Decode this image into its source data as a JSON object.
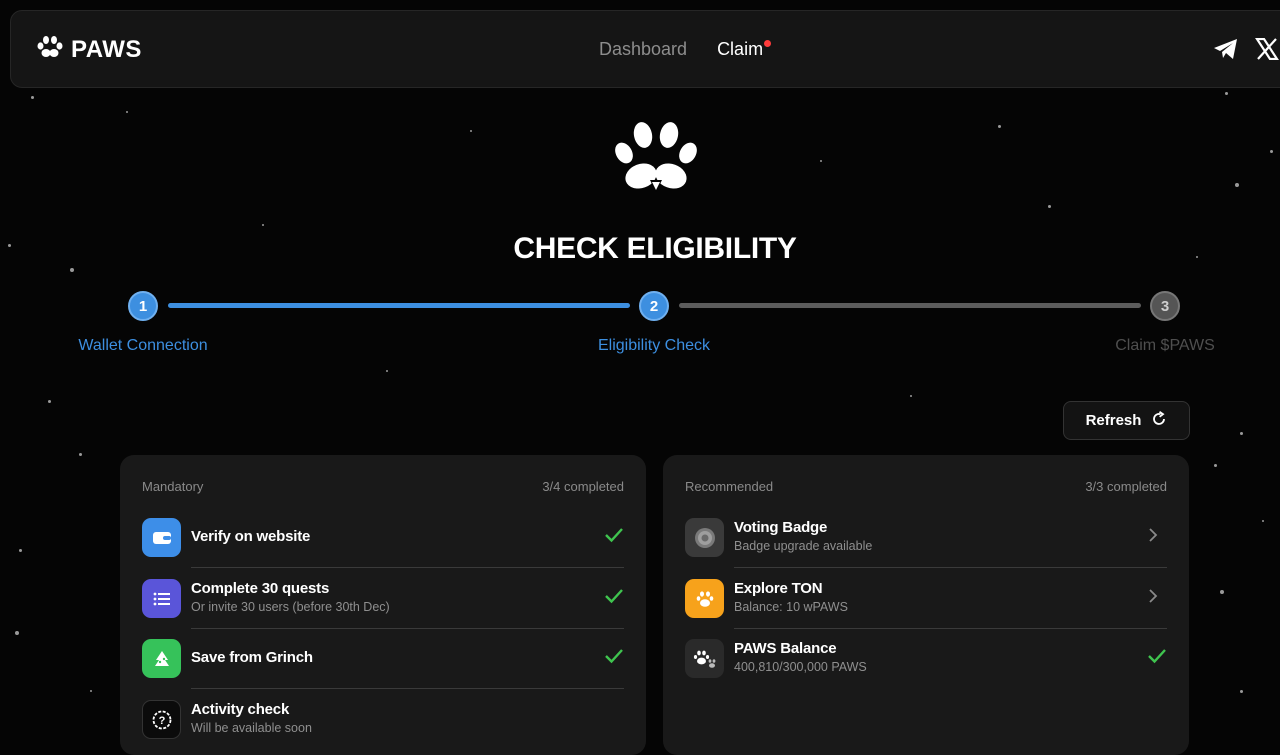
{
  "header": {
    "brand": "PAWS",
    "nav": [
      {
        "label": "Dashboard",
        "active": false
      },
      {
        "label": "Claim",
        "active": true,
        "notification_dot": true
      }
    ],
    "socials": [
      "telegram-icon",
      "x-icon"
    ]
  },
  "hero": {
    "title": "CHECK ELIGIBILITY"
  },
  "stepper": {
    "steps": [
      {
        "number": "1",
        "label": "Wallet Connection",
        "state": "done"
      },
      {
        "number": "2",
        "label": "Eligibility Check",
        "state": "current"
      },
      {
        "number": "3",
        "label": "Claim $PAWS",
        "state": "pending"
      }
    ]
  },
  "refresh": {
    "label": "Refresh"
  },
  "mandatory": {
    "title": "Mandatory",
    "progress": "3/4 completed",
    "tasks": [
      {
        "title": "Verify on website",
        "subtitle": "",
        "done": true
      },
      {
        "title": "Complete 30 quests",
        "subtitle": "Or invite 30 users (before 30th Dec)",
        "done": true
      },
      {
        "title": "Save from Grinch",
        "subtitle": "",
        "done": true
      },
      {
        "title": "Activity check",
        "subtitle": "Will be available soon",
        "done": false
      }
    ]
  },
  "recommended": {
    "title": "Recommended",
    "progress": "3/3 completed",
    "tasks": [
      {
        "title": "Voting Badge",
        "subtitle": "Badge upgrade available",
        "status": "chevron"
      },
      {
        "title": "Explore TON",
        "subtitle": "Balance: 10 wPAWS",
        "status": "chevron"
      },
      {
        "title": "PAWS Balance",
        "subtitle": "400,810/300,000 PAWS",
        "status": "done"
      }
    ]
  },
  "colors": {
    "accent_blue": "#3d8fe0",
    "check_green": "#3fc44f",
    "notification_red": "#ff3b3b"
  }
}
